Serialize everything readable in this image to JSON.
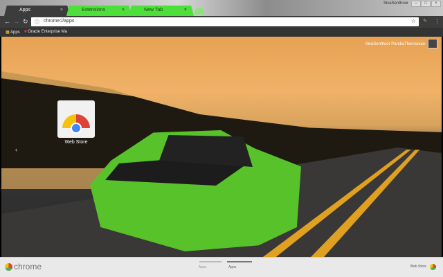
{
  "tabs": [
    {
      "label": "Apps",
      "active": true
    },
    {
      "label": "Extensions",
      "active": false
    },
    {
      "label": "New Tab",
      "active": false
    }
  ],
  "window": {
    "user": "SivaSenthoor",
    "minimize": "–",
    "maximize": "□",
    "close": "×"
  },
  "toolbar": {
    "back": "←",
    "forward": "→",
    "reload": "↻",
    "url": "chrome://apps",
    "info": "ⓘ",
    "star": "☆",
    "menu": "⋮"
  },
  "bookmarks": [
    {
      "label": "Apps"
    },
    {
      "label": "Oracle Enterprise Ma"
    }
  ],
  "profile": {
    "name": "SivaSenthoor PandiaThennavan"
  },
  "apps": [
    {
      "label": "Web Store"
    }
  ],
  "nav_arrow": "‹",
  "bottom": {
    "logo": "chrome",
    "pages": [
      "Apps",
      "Apps"
    ],
    "webstore": "Web Store"
  },
  "colors": {
    "tab_accent": "#4ee03a",
    "toolbar": "#3c3c3c"
  }
}
